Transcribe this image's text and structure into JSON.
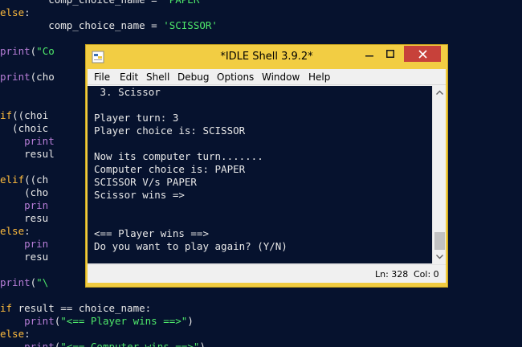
{
  "editor": {
    "lines": [
      {
        "tokens": [
          {
            "t": "        comp_choice_name = ",
            "c": "plain"
          },
          {
            "t": "'PAPER'",
            "c": "str"
          }
        ]
      },
      {
        "tokens": [
          {
            "t": "else",
            "c": "kw"
          },
          {
            "t": ":",
            "c": "plain"
          }
        ]
      },
      {
        "tokens": [
          {
            "t": "        comp_choice_name = ",
            "c": "plain"
          },
          {
            "t": "'SCISSOR'",
            "c": "str"
          }
        ]
      },
      {
        "tokens": []
      },
      {
        "tokens": [
          {
            "t": "print",
            "c": "fn"
          },
          {
            "t": "(",
            "c": "plain"
          },
          {
            "t": "\"Co",
            "c": "str"
          }
        ]
      },
      {
        "tokens": []
      },
      {
        "tokens": [
          {
            "t": "print",
            "c": "fn"
          },
          {
            "t": "(cho",
            "c": "plain"
          }
        ]
      },
      {
        "tokens": []
      },
      {
        "tokens": []
      },
      {
        "tokens": [
          {
            "t": "if",
            "c": "kw"
          },
          {
            "t": "((choi",
            "c": "plain"
          }
        ]
      },
      {
        "tokens": [
          {
            "t": "  (choic",
            "c": "plain"
          }
        ]
      },
      {
        "tokens": [
          {
            "t": "    ",
            "c": "plain"
          },
          {
            "t": "print",
            "c": "fn"
          }
        ]
      },
      {
        "tokens": [
          {
            "t": "    resul",
            "c": "plain"
          }
        ]
      },
      {
        "tokens": []
      },
      {
        "tokens": [
          {
            "t": "elif",
            "c": "kw"
          },
          {
            "t": "((ch",
            "c": "plain"
          }
        ]
      },
      {
        "tokens": [
          {
            "t": "    (cho",
            "c": "plain"
          }
        ]
      },
      {
        "tokens": [
          {
            "t": "    ",
            "c": "plain"
          },
          {
            "t": "prin",
            "c": "fn"
          }
        ]
      },
      {
        "tokens": [
          {
            "t": "    resu",
            "c": "plain"
          }
        ]
      },
      {
        "tokens": [
          {
            "t": "else",
            "c": "kw"
          },
          {
            "t": ":",
            "c": "plain"
          }
        ]
      },
      {
        "tokens": [
          {
            "t": "    ",
            "c": "plain"
          },
          {
            "t": "prin",
            "c": "fn"
          }
        ]
      },
      {
        "tokens": [
          {
            "t": "    resu",
            "c": "plain"
          }
        ]
      },
      {
        "tokens": []
      },
      {
        "tokens": [
          {
            "t": "print",
            "c": "fn"
          },
          {
            "t": "(",
            "c": "plain"
          },
          {
            "t": "\"\\",
            "c": "str"
          }
        ]
      },
      {
        "tokens": []
      },
      {
        "tokens": [
          {
            "t": "if",
            "c": "kw"
          },
          {
            "t": " result == choice_name:",
            "c": "plain"
          }
        ]
      },
      {
        "tokens": [
          {
            "t": "    ",
            "c": "plain"
          },
          {
            "t": "print",
            "c": "fn"
          },
          {
            "t": "(",
            "c": "plain"
          },
          {
            "t": "\"<== Player wins ==>\"",
            "c": "str"
          },
          {
            "t": ")",
            "c": "plain"
          }
        ]
      },
      {
        "tokens": [
          {
            "t": "else",
            "c": "kw"
          },
          {
            "t": ":",
            "c": "plain"
          }
        ]
      },
      {
        "tokens": [
          {
            "t": "    ",
            "c": "plain"
          },
          {
            "t": "print",
            "c": "fn"
          },
          {
            "t": "(",
            "c": "plain"
          },
          {
            "t": "\"<== Computer wins ==>\"",
            "c": "str"
          },
          {
            "t": ")",
            "c": "plain"
          }
        ]
      }
    ]
  },
  "idle": {
    "title": "*IDLE Shell 3.9.2*",
    "menus": [
      "File",
      "Edit",
      "Shell",
      "Debug",
      "Options",
      "Window",
      "Help"
    ],
    "shell_lines": [
      " 3. Scissor",
      "",
      "Player turn: 3",
      "Player choice is: SCISSOR",
      "",
      "Now its computer turn.......",
      "Computer choice is: PAPER",
      "SCISSOR V/s PAPER",
      "Scissor wins =>",
      "",
      "",
      "<== Player wins ==>",
      "Do you want to play again? (Y/N)"
    ],
    "status": {
      "line": "Ln: 328",
      "col": "Col: 0"
    }
  },
  "colors": {
    "background": "#06122e",
    "window_frame": "#f0cb40",
    "close_button": "#c7413a",
    "keyword": "#ffbc3d",
    "builtin": "#b67dd6",
    "string": "#4ee86a",
    "text": "#e8e8e8"
  },
  "icons": [
    "idle-app-icon",
    "minimize-icon",
    "maximize-icon",
    "close-icon",
    "scroll-up-arrow-icon",
    "scroll-down-arrow-icon"
  ]
}
